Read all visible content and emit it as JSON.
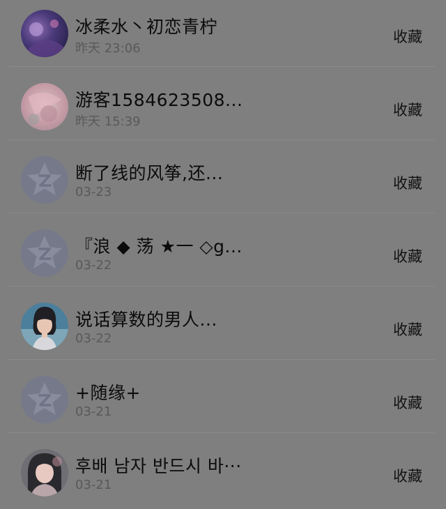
{
  "favorites": [
    {
      "name": "冰柔水丶初恋青柠",
      "time": "昨天 23:06",
      "action": "收藏",
      "avatar": "photo-avatar-purple"
    },
    {
      "name": "游客1584623508...",
      "time": "昨天 15:39",
      "action": "收藏",
      "avatar": "photo-avatar-pink"
    },
    {
      "name": "断了线的风筝,还...",
      "time": "03-23",
      "action": "收藏",
      "avatar": "default-star-avatar"
    },
    {
      "name": "『浪 ◆ 荡 ★一 ◇g...",
      "time": "03-22",
      "action": "收藏",
      "avatar": "default-star-avatar"
    },
    {
      "name": "说话算数的男人...",
      "time": "03-22",
      "action": "收藏",
      "avatar": "photo-avatar-cartoon-girl"
    },
    {
      "name": "+随缘+",
      "time": "03-21",
      "action": "收藏",
      "avatar": "default-star-avatar"
    },
    {
      "name": "후배 남자 반드시 바···",
      "time": "03-21",
      "action": "收藏",
      "avatar": "photo-avatar-girl"
    }
  ]
}
